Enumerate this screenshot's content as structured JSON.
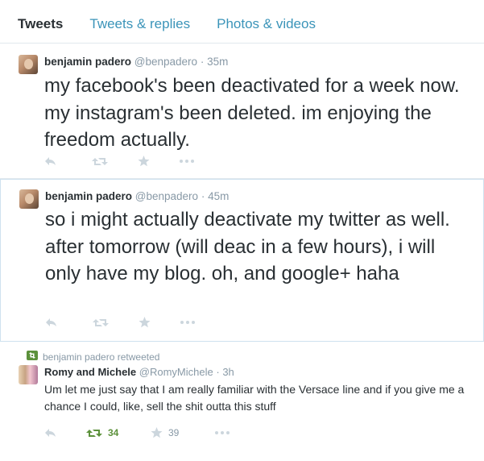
{
  "tabs": [
    "Tweets",
    "Tweets & replies",
    "Photos & videos"
  ],
  "tweets": [
    {
      "name": "benjamin padero",
      "handle": "@benpadero",
      "time": "35m",
      "text": "my facebook's been deactivated for a week now. my instagram's been deleted. im enjoying the freedom actually."
    },
    {
      "name": "benjamin padero",
      "handle": "@benpadero",
      "time": "45m",
      "text": "so i might actually deactivate my twitter as well. after tomorrow (will deac in a few hours), i will only have my blog. oh, and google+ haha"
    },
    {
      "context": "benjamin padero retweeted",
      "name": "Romy and Michele",
      "handle": "@RomyMichele",
      "time": "3h",
      "text": "Um let me just say that I am really familiar with the Versace line and if you give me a chance I could, like, sell the shit outta this stuff",
      "retweets": "34",
      "favorites": "39"
    }
  ],
  "separator": "·",
  "colors": {
    "link": "#3b94b9",
    "retweet": "#5c913b",
    "muted": "#8899a6",
    "icon": "#ccd6dd",
    "border": "#e1e8ed",
    "highlight_border": "#cfe2ef"
  },
  "icons": [
    "reply-icon",
    "retweet-icon",
    "favorite-icon",
    "more-icon"
  ]
}
